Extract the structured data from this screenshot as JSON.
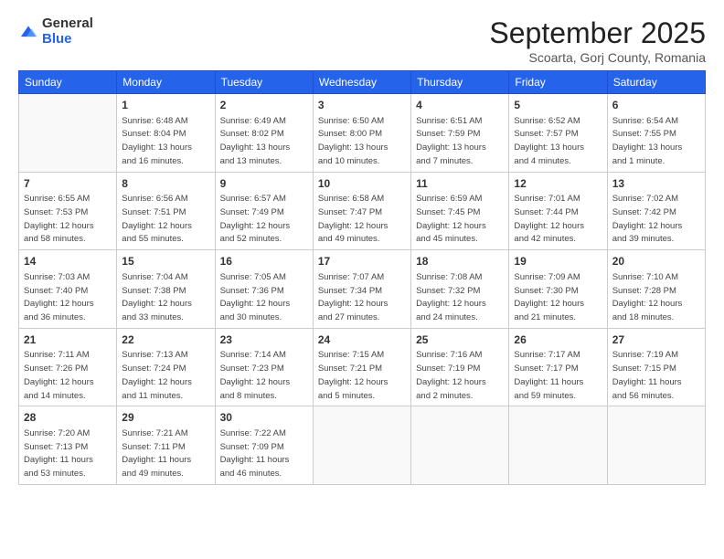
{
  "logo": {
    "general": "General",
    "blue": "Blue"
  },
  "header": {
    "month": "September 2025",
    "location": "Scoarta, Gorj County, Romania"
  },
  "days_of_week": [
    "Sunday",
    "Monday",
    "Tuesday",
    "Wednesday",
    "Thursday",
    "Friday",
    "Saturday"
  ],
  "weeks": [
    [
      {
        "day": "",
        "info": ""
      },
      {
        "day": "1",
        "info": "Sunrise: 6:48 AM\nSunset: 8:04 PM\nDaylight: 13 hours\nand 16 minutes."
      },
      {
        "day": "2",
        "info": "Sunrise: 6:49 AM\nSunset: 8:02 PM\nDaylight: 13 hours\nand 13 minutes."
      },
      {
        "day": "3",
        "info": "Sunrise: 6:50 AM\nSunset: 8:00 PM\nDaylight: 13 hours\nand 10 minutes."
      },
      {
        "day": "4",
        "info": "Sunrise: 6:51 AM\nSunset: 7:59 PM\nDaylight: 13 hours\nand 7 minutes."
      },
      {
        "day": "5",
        "info": "Sunrise: 6:52 AM\nSunset: 7:57 PM\nDaylight: 13 hours\nand 4 minutes."
      },
      {
        "day": "6",
        "info": "Sunrise: 6:54 AM\nSunset: 7:55 PM\nDaylight: 13 hours\nand 1 minute."
      }
    ],
    [
      {
        "day": "7",
        "info": "Sunrise: 6:55 AM\nSunset: 7:53 PM\nDaylight: 12 hours\nand 58 minutes."
      },
      {
        "day": "8",
        "info": "Sunrise: 6:56 AM\nSunset: 7:51 PM\nDaylight: 12 hours\nand 55 minutes."
      },
      {
        "day": "9",
        "info": "Sunrise: 6:57 AM\nSunset: 7:49 PM\nDaylight: 12 hours\nand 52 minutes."
      },
      {
        "day": "10",
        "info": "Sunrise: 6:58 AM\nSunset: 7:47 PM\nDaylight: 12 hours\nand 49 minutes."
      },
      {
        "day": "11",
        "info": "Sunrise: 6:59 AM\nSunset: 7:45 PM\nDaylight: 12 hours\nand 45 minutes."
      },
      {
        "day": "12",
        "info": "Sunrise: 7:01 AM\nSunset: 7:44 PM\nDaylight: 12 hours\nand 42 minutes."
      },
      {
        "day": "13",
        "info": "Sunrise: 7:02 AM\nSunset: 7:42 PM\nDaylight: 12 hours\nand 39 minutes."
      }
    ],
    [
      {
        "day": "14",
        "info": "Sunrise: 7:03 AM\nSunset: 7:40 PM\nDaylight: 12 hours\nand 36 minutes."
      },
      {
        "day": "15",
        "info": "Sunrise: 7:04 AM\nSunset: 7:38 PM\nDaylight: 12 hours\nand 33 minutes."
      },
      {
        "day": "16",
        "info": "Sunrise: 7:05 AM\nSunset: 7:36 PM\nDaylight: 12 hours\nand 30 minutes."
      },
      {
        "day": "17",
        "info": "Sunrise: 7:07 AM\nSunset: 7:34 PM\nDaylight: 12 hours\nand 27 minutes."
      },
      {
        "day": "18",
        "info": "Sunrise: 7:08 AM\nSunset: 7:32 PM\nDaylight: 12 hours\nand 24 minutes."
      },
      {
        "day": "19",
        "info": "Sunrise: 7:09 AM\nSunset: 7:30 PM\nDaylight: 12 hours\nand 21 minutes."
      },
      {
        "day": "20",
        "info": "Sunrise: 7:10 AM\nSunset: 7:28 PM\nDaylight: 12 hours\nand 18 minutes."
      }
    ],
    [
      {
        "day": "21",
        "info": "Sunrise: 7:11 AM\nSunset: 7:26 PM\nDaylight: 12 hours\nand 14 minutes."
      },
      {
        "day": "22",
        "info": "Sunrise: 7:13 AM\nSunset: 7:24 PM\nDaylight: 12 hours\nand 11 minutes."
      },
      {
        "day": "23",
        "info": "Sunrise: 7:14 AM\nSunset: 7:23 PM\nDaylight: 12 hours\nand 8 minutes."
      },
      {
        "day": "24",
        "info": "Sunrise: 7:15 AM\nSunset: 7:21 PM\nDaylight: 12 hours\nand 5 minutes."
      },
      {
        "day": "25",
        "info": "Sunrise: 7:16 AM\nSunset: 7:19 PM\nDaylight: 12 hours\nand 2 minutes."
      },
      {
        "day": "26",
        "info": "Sunrise: 7:17 AM\nSunset: 7:17 PM\nDaylight: 11 hours\nand 59 minutes."
      },
      {
        "day": "27",
        "info": "Sunrise: 7:19 AM\nSunset: 7:15 PM\nDaylight: 11 hours\nand 56 minutes."
      }
    ],
    [
      {
        "day": "28",
        "info": "Sunrise: 7:20 AM\nSunset: 7:13 PM\nDaylight: 11 hours\nand 53 minutes."
      },
      {
        "day": "29",
        "info": "Sunrise: 7:21 AM\nSunset: 7:11 PM\nDaylight: 11 hours\nand 49 minutes."
      },
      {
        "day": "30",
        "info": "Sunrise: 7:22 AM\nSunset: 7:09 PM\nDaylight: 11 hours\nand 46 minutes."
      },
      {
        "day": "",
        "info": ""
      },
      {
        "day": "",
        "info": ""
      },
      {
        "day": "",
        "info": ""
      },
      {
        "day": "",
        "info": ""
      }
    ]
  ]
}
